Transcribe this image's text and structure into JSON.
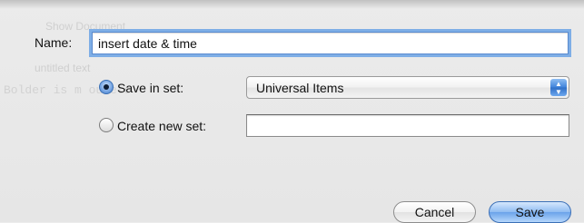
{
  "background_text": {
    "line1": "Show Document",
    "line2": "untitled text",
    "line3": "Bolder is m                   ou etc"
  },
  "dialog": {
    "name_label": "Name:",
    "name_value": "insert date & time",
    "save_in_set_label": "Save in set:",
    "save_in_set_selected": true,
    "set_popup_value": "Universal Items",
    "create_new_set_label": "Create new set:",
    "create_new_set_selected": false,
    "new_set_value": "",
    "cancel_label": "Cancel",
    "save_label": "Save"
  },
  "colors": {
    "accent": "#5a8bcf",
    "window_bg": "#e8e8e8"
  },
  "icons": {
    "popup_arrows": "up-down-chevron-icon"
  }
}
